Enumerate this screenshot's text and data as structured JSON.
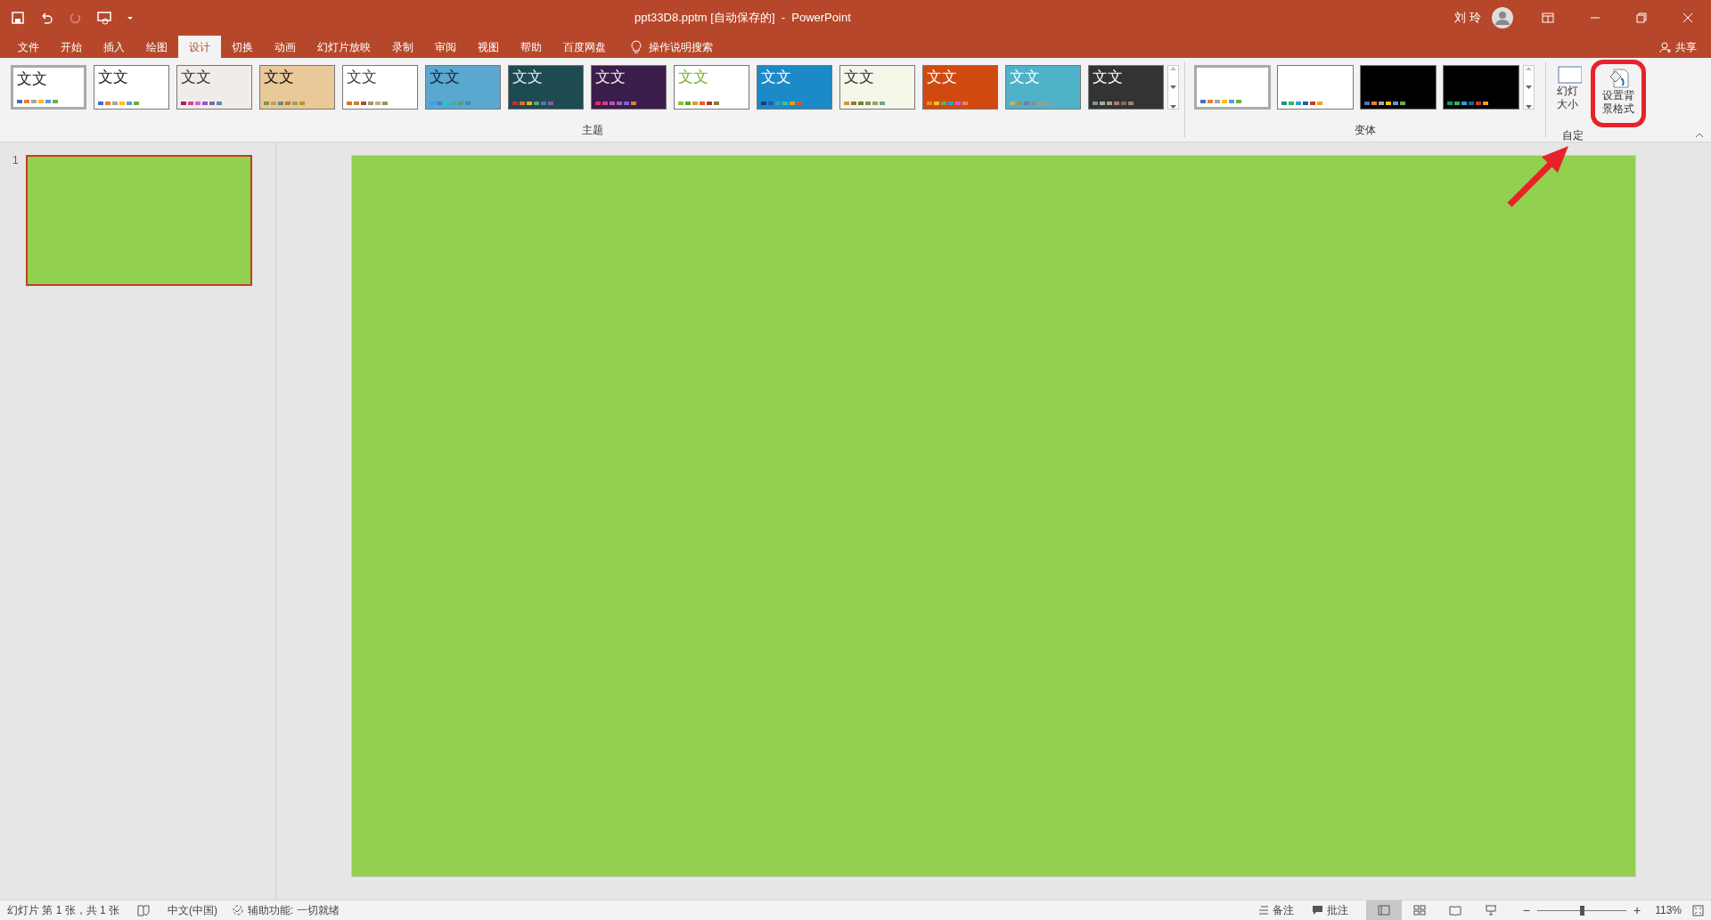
{
  "window": {
    "title": "ppt33D8.pptm [自动保存的]  -  PowerPoint",
    "user": "刘 玲"
  },
  "tabs": [
    {
      "label": "文件",
      "selected": false
    },
    {
      "label": "开始",
      "selected": false
    },
    {
      "label": "插入",
      "selected": false
    },
    {
      "label": "绘图",
      "selected": false
    },
    {
      "label": "设计",
      "selected": true
    },
    {
      "label": "切换",
      "selected": false
    },
    {
      "label": "动画",
      "selected": false
    },
    {
      "label": "幻灯片放映",
      "selected": false
    },
    {
      "label": "录制",
      "selected": false
    },
    {
      "label": "审阅",
      "selected": false
    },
    {
      "label": "视图",
      "selected": false
    },
    {
      "label": "帮助",
      "selected": false
    },
    {
      "label": "百度网盘",
      "selected": false
    }
  ],
  "tell_me": "操作说明搜索",
  "share": "共享",
  "ribbon": {
    "themes_group": "主题",
    "themes": [
      {
        "label": "文文",
        "selected": true
      },
      {
        "label": "文文",
        "selected": false
      },
      {
        "label": "文文",
        "selected": false
      },
      {
        "label": "文文",
        "selected": false
      },
      {
        "label": "文文",
        "selected": false
      },
      {
        "label": "文文",
        "selected": false
      },
      {
        "label": "文文",
        "selected": false
      },
      {
        "label": "文文",
        "selected": false
      },
      {
        "label": "文文",
        "selected": false
      },
      {
        "label": "文文",
        "selected": false
      },
      {
        "label": "文文",
        "selected": false
      },
      {
        "label": "文文",
        "selected": false
      },
      {
        "label": "文文",
        "selected": false
      },
      {
        "label": "文文",
        "selected": false
      }
    ],
    "variants_group": "变体",
    "variants": [
      {
        "selected": true
      },
      {
        "selected": false
      },
      {
        "selected": false
      },
      {
        "selected": false
      }
    ],
    "customize_group": "自定",
    "slide_size": [
      "幻灯",
      "大小"
    ],
    "format_background": [
      "设置背",
      "景格式"
    ]
  },
  "slides": [
    {
      "number": "1",
      "selected": true,
      "color": "#92d050"
    }
  ],
  "status_bar": {
    "slide_info": "幻灯片 第 1 张，共 1 张",
    "language": "中文(中国)",
    "accessibility": "辅助功能: 一切就绪",
    "notes": "备注",
    "comments": "批注",
    "views": [
      {
        "selected": true
      },
      {
        "selected": false
      },
      {
        "selected": false
      },
      {
        "selected": false
      }
    ],
    "zoom": {
      "level": 0.5,
      "reading": "113%",
      "minus": "−",
      "plus": "+"
    }
  }
}
